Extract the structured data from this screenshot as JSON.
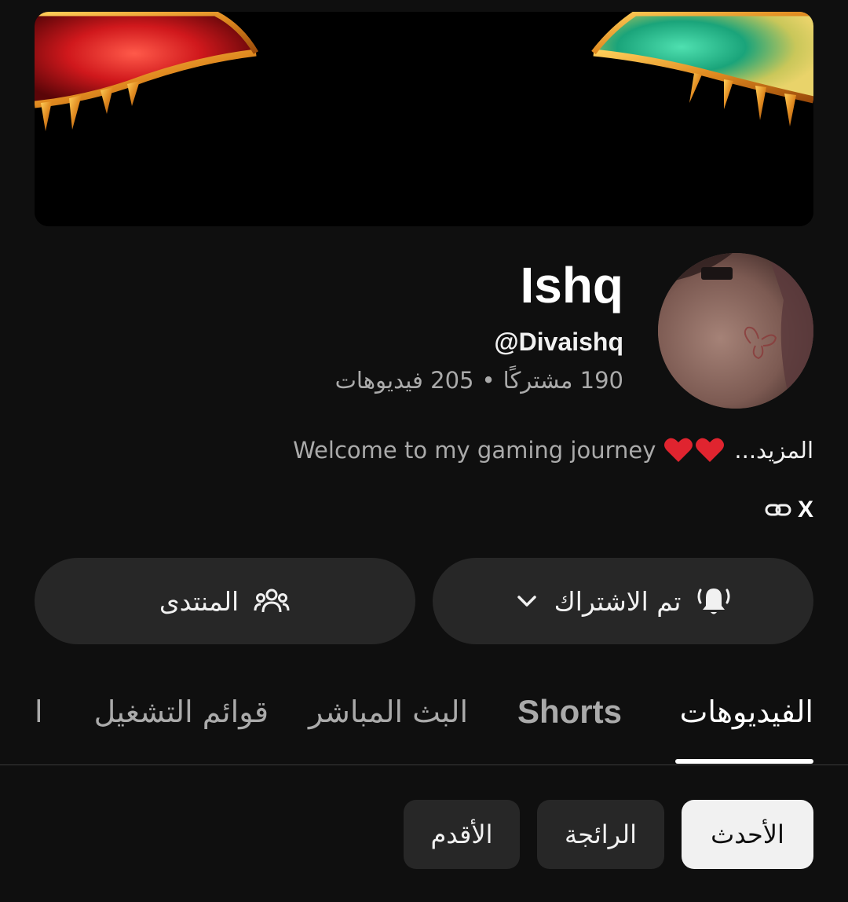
{
  "channel": {
    "name": "Ishq",
    "handle": "@Divaishq",
    "subscribers": "190 مشتركًا",
    "separator": "•",
    "videos_count": "205 فيديوهات",
    "description": "Welcome to my gaming journey",
    "more_label": "المزيد...",
    "link_label": "X"
  },
  "actions": {
    "subscribed_label": "تم الاشتراك",
    "community_label": "المنتدى"
  },
  "tabs": [
    {
      "label": "الفيديوهات",
      "active": true
    },
    {
      "label": "Shorts",
      "active": false
    },
    {
      "label": "البث المباشر",
      "active": false
    },
    {
      "label": "قوائم التشغيل",
      "active": false
    },
    {
      "label": "ا",
      "active": false
    }
  ],
  "filters": [
    {
      "label": "الأحدث",
      "selected": true
    },
    {
      "label": "الرائجة",
      "selected": false
    },
    {
      "label": "الأقدم",
      "selected": false
    }
  ],
  "colors": {
    "background": "#0f0f0f",
    "surface": "#272727",
    "text_primary": "#f1f1f1",
    "text_secondary": "#aaaaaa",
    "heart": "#e0242f"
  },
  "icons": {
    "notifications": "bell-ringing-icon",
    "dropdown": "chevron-down-icon",
    "community": "people-icon",
    "link": "link-icon",
    "heart": "heart-icon"
  }
}
